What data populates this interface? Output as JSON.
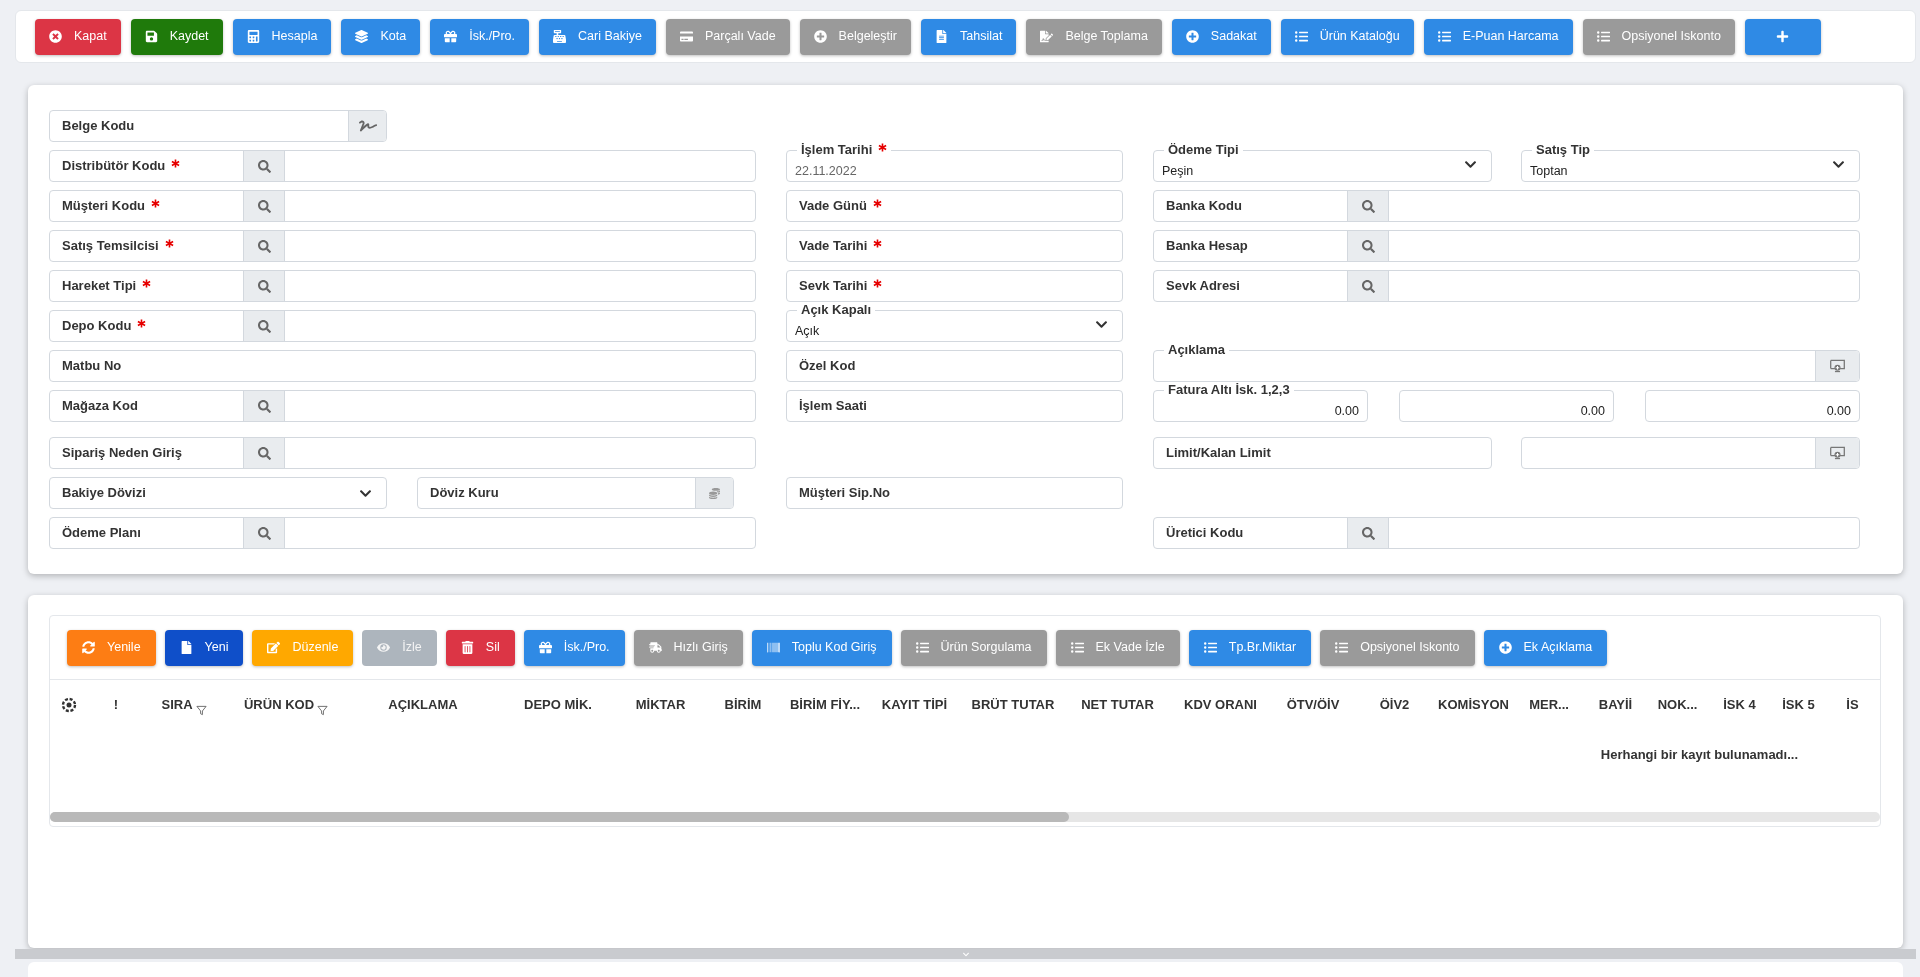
{
  "toolbar": {
    "buttons": [
      {
        "label": "Kapat",
        "color": "#dc3545",
        "disabled": false
      },
      {
        "label": "Kaydet",
        "color": "#1f7a0b",
        "disabled": false
      },
      {
        "label": "Hesapla",
        "color": "#2f8ae5",
        "disabled": false
      },
      {
        "label": "Kota",
        "color": "#2f8ae5",
        "disabled": false
      },
      {
        "label": "İsk./Pro.",
        "color": "#2f8ae5",
        "disabled": false
      },
      {
        "label": "Cari Bakiye",
        "color": "#2f8ae5",
        "disabled": false
      },
      {
        "label": "Parçalı Vade",
        "color": "#9a9a9a",
        "disabled": false
      },
      {
        "label": "Belgeleştir",
        "color": "#9a9a9a",
        "disabled": false
      },
      {
        "label": "Tahsilat",
        "color": "#2f8ae5",
        "disabled": false
      },
      {
        "label": "Belge Toplama",
        "color": "#9a9a9a",
        "disabled": false
      },
      {
        "label": "Sadakat",
        "color": "#2f8ae5",
        "disabled": false
      },
      {
        "label": "Ürün Kataloğu",
        "color": "#2f8ae5",
        "disabled": false
      },
      {
        "label": "E-Puan Harcama",
        "color": "#2f8ae5",
        "disabled": false
      },
      {
        "label": "Opsiyonel Iskonto",
        "color": "#9a9a9a",
        "disabled": false
      },
      {
        "color": "#2f8ae5",
        "disabled": false
      }
    ]
  },
  "form": {
    "left": [
      {
        "kind": "signature",
        "label": "Belge Kodu",
        "required": false
      },
      {
        "kind": "lookup",
        "label": "Distribütör Kodu",
        "required": true
      },
      {
        "kind": "lookup",
        "label": "Müşteri Kodu",
        "required": true
      },
      {
        "kind": "lookup",
        "label": "Satış Temsilcisi",
        "required": true
      },
      {
        "kind": "lookup",
        "label": "Hareket Tipi",
        "required": true
      },
      {
        "kind": "lookup",
        "label": "Depo Kodu",
        "required": true
      },
      {
        "kind": "text",
        "label": "Matbu No",
        "required": false
      },
      {
        "kind": "lookup",
        "label": "Mağaza Kod",
        "required": false
      },
      {
        "kind": "lookup",
        "label": "Sipariş Neden Giriş",
        "required": false
      },
      {
        "kind": "select",
        "label": "Bakiye Dövizi",
        "required": false
      },
      {
        "kind": "currency",
        "label": "Döviz Kuru",
        "required": false
      },
      {
        "kind": "lookup",
        "label": "Ödeme Planı",
        "required": false
      }
    ],
    "middle": [
      {
        "kind": "date",
        "label": "İşlem Tarihi",
        "value": "22.11.2022",
        "required": true
      },
      {
        "kind": "text",
        "label": "Vade Günü",
        "required": true
      },
      {
        "kind": "text",
        "label": "Vade Tarihi",
        "required": true
      },
      {
        "kind": "text",
        "label": "Sevk Tarihi",
        "required": true
      },
      {
        "kind": "select",
        "label": "Açık Kapalı",
        "value": "Açık",
        "required": false
      },
      {
        "kind": "text",
        "label": "Özel Kod",
        "required": false
      },
      {
        "kind": "text",
        "label": "İşlem Saati",
        "required": false
      },
      {
        "kind": "text",
        "label": "Müşteri Sip.No",
        "required": false
      }
    ],
    "right": [
      {
        "kind": "select",
        "label": "Ödeme Tipi",
        "value": "Peşin",
        "required": false
      },
      {
        "kind": "select",
        "label": "Satış Tip",
        "value": "Toptan",
        "required": false
      },
      {
        "kind": "lookup",
        "label": "Banka Kodu",
        "required": false
      },
      {
        "kind": "lookup",
        "label": "Banka Hesap",
        "required": false
      },
      {
        "kind": "lookup",
        "label": "Sevk Adresi",
        "required": false
      },
      {
        "kind": "action",
        "label": "Açıklama",
        "required": false
      },
      {
        "kind": "number",
        "label": "Fatura Altı İsk. 1,2,3",
        "value": "0.00",
        "required": false
      },
      {
        "kind": "number",
        "value": "0.00"
      },
      {
        "kind": "number",
        "value": "0.00"
      },
      {
        "kind": "text",
        "label": "Limit/Kalan Limit",
        "required": false
      },
      {
        "kind": "action"
      },
      {
        "kind": "lookup",
        "label": "Üretici Kodu",
        "required": false
      }
    ]
  },
  "grid_toolbar": {
    "buttons": [
      {
        "label": "Yenile",
        "color": "#fd7d14",
        "disabled": false
      },
      {
        "label": "Yeni",
        "color": "#0f4fc9",
        "disabled": false
      },
      {
        "label": "Düzenle",
        "color": "#ffa800",
        "disabled": false
      },
      {
        "label": "İzle",
        "color": "#adb5bd",
        "disabled": true
      },
      {
        "label": "Sil",
        "color": "#dc3545",
        "disabled": false
      },
      {
        "label": "İsk./Pro.",
        "color": "#2f8ae5",
        "disabled": false
      },
      {
        "label": "Hızlı Giriş",
        "color": "#9a9a9a",
        "disabled": false
      },
      {
        "label": "Toplu Kod Giriş",
        "color": "#2f8ae5",
        "disabled": false
      },
      {
        "label": "Ürün Sorgulama",
        "color": "#9a9a9a",
        "disabled": false
      },
      {
        "label": "Ek Vade İzle",
        "color": "#9a9a9a",
        "disabled": false
      },
      {
        "label": "Tp.Br.Miktar",
        "color": "#2f8ae5",
        "disabled": false
      },
      {
        "label": "Opsiyonel Iskonto",
        "color": "#9a9a9a",
        "disabled": false
      },
      {
        "label": "Ek Açıklama",
        "color": "#2f8ae5",
        "disabled": false
      }
    ]
  },
  "table": {
    "columns": [
      {
        "filterable": false
      },
      {
        "label": "!",
        "filterable": false
      },
      {
        "label": "SIRA",
        "filterable": true
      },
      {
        "label": "ÜRÜN KOD",
        "filterable": true
      },
      {
        "label": "AÇIKLAMA",
        "filterable": false
      },
      {
        "label": "DEPO MİK.",
        "filterable": false
      },
      {
        "label": "MİKTAR",
        "filterable": false
      },
      {
        "label": "BİRİM",
        "filterable": false
      },
      {
        "label": "BİRİM FİY...",
        "filterable": false
      },
      {
        "label": "KAYIT TİPİ",
        "filterable": false
      },
      {
        "label": "BRÜT TUTAR",
        "filterable": false
      },
      {
        "label": "NET TUTAR",
        "filterable": false
      },
      {
        "label": "KDV ORANI",
        "filterable": false
      },
      {
        "label": "ÖTV/ÖİV",
        "filterable": false
      },
      {
        "label": "ÖİV2",
        "filterable": false
      },
      {
        "label": "KOMİSYON",
        "filterable": false
      },
      {
        "label": "MER...",
        "filterable": false
      },
      {
        "label": "BAYİİ",
        "filterable": false
      },
      {
        "label": "NOK...",
        "filterable": false
      },
      {
        "label": "İSK 4",
        "filterable": false
      },
      {
        "label": "İSK 5",
        "filterable": false
      },
      {
        "label": "İS",
        "filterable": false
      }
    ],
    "empty_message": "Herhangi bir kayıt bulunamadı..."
  }
}
